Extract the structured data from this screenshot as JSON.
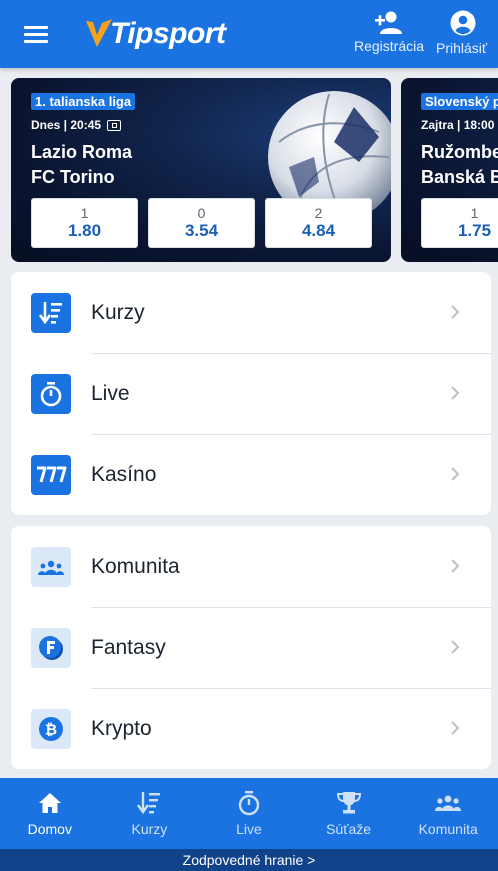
{
  "header": {
    "logo_text": "Tipsport",
    "register_label": "Registrácia",
    "login_label": "Prihlásiť"
  },
  "matches": [
    {
      "league": "1. talianska liga",
      "time": "Dnes | 20:45",
      "team_home": "Lazio Roma",
      "team_away": "FC Torino",
      "odds": [
        {
          "label": "1",
          "value": "1.80"
        },
        {
          "label": "0",
          "value": "3.54"
        },
        {
          "label": "2",
          "value": "4.84"
        }
      ]
    },
    {
      "league": "Slovenský p",
      "time": "Zajtra | 18:00",
      "team_home": "Ružomber",
      "team_away": "Banská By",
      "odds": [
        {
          "label": "1",
          "value": "1.75"
        }
      ]
    }
  ],
  "menu_primary": [
    {
      "label": "Kurzy",
      "icon": "odds-sort-icon"
    },
    {
      "label": "Live",
      "icon": "stopwatch-icon"
    },
    {
      "label": "Kasíno",
      "icon": "777-icon"
    }
  ],
  "menu_secondary": [
    {
      "label": "Komunita",
      "icon": "community-icon"
    },
    {
      "label": "Fantasy",
      "icon": "fantasy-coin-icon"
    },
    {
      "label": "Krypto",
      "icon": "bitcoin-icon"
    }
  ],
  "bottom_nav": [
    {
      "label": "Domov",
      "icon": "home-icon",
      "active": true
    },
    {
      "label": "Kurzy",
      "icon": "odds-sort-icon",
      "active": false
    },
    {
      "label": "Live",
      "icon": "stopwatch-icon",
      "active": false
    },
    {
      "label": "Súťaže",
      "icon": "trophy-icon",
      "active": false
    },
    {
      "label": "Komunita",
      "icon": "community-icon",
      "active": false
    }
  ],
  "responsible_gaming": "Zodpovedné hranie >",
  "colors": {
    "brand_blue": "#1a73e0",
    "logo_orange": "#f7a21b",
    "odds_text": "#1c5fb8",
    "footer_bar": "#10438a"
  }
}
